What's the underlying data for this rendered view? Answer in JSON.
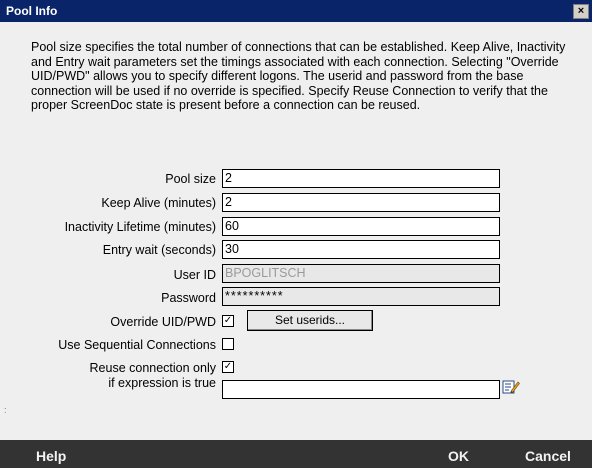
{
  "window": {
    "title": "Pool Info",
    "close_glyph": "×"
  },
  "description": "Pool size specifies the total number of connections that can be established.  Keep Alive, Inactivity and Entry wait parameters set the timings associated with each connection.  Selecting \"Override UID/PWD\" allows you to specify different logons. The userid and password from the base connection will be used if no override is specified. Specify Reuse Connection to verify that the proper ScreenDoc state is present before a connection can be reused.",
  "form": {
    "pool_size": {
      "label": "Pool size",
      "value": "2"
    },
    "keep_alive": {
      "label": "Keep Alive (minutes)",
      "value": "2"
    },
    "inactivity_lifetime": {
      "label": "Inactivity Lifetime (minutes)",
      "value": "60"
    },
    "entry_wait": {
      "label": "Entry wait (seconds)",
      "value": "30"
    },
    "user_id": {
      "label": "User ID",
      "value": "BPOGLITSCH"
    },
    "password": {
      "label": "Password",
      "value": "**********"
    },
    "override_uid_pwd": {
      "label": "Override UID/PWD",
      "checked": true
    },
    "set_userids_button": "Set userids...",
    "use_sequential": {
      "label": "Use Sequential Connections",
      "checked": false
    },
    "reuse_connection": {
      "label_line1": "Reuse connection only",
      "label_line2": "if expression is true",
      "checked": true,
      "expression": ""
    }
  },
  "footer": {
    "help": "Help",
    "ok": "OK",
    "cancel": "Cancel"
  },
  "icons": {
    "close": "close-icon",
    "expression_editor": "edit-expression-icon"
  },
  "colors": {
    "titlebar": "#0a246a",
    "footer": "#333333",
    "dialog_bg": "#efefef"
  }
}
